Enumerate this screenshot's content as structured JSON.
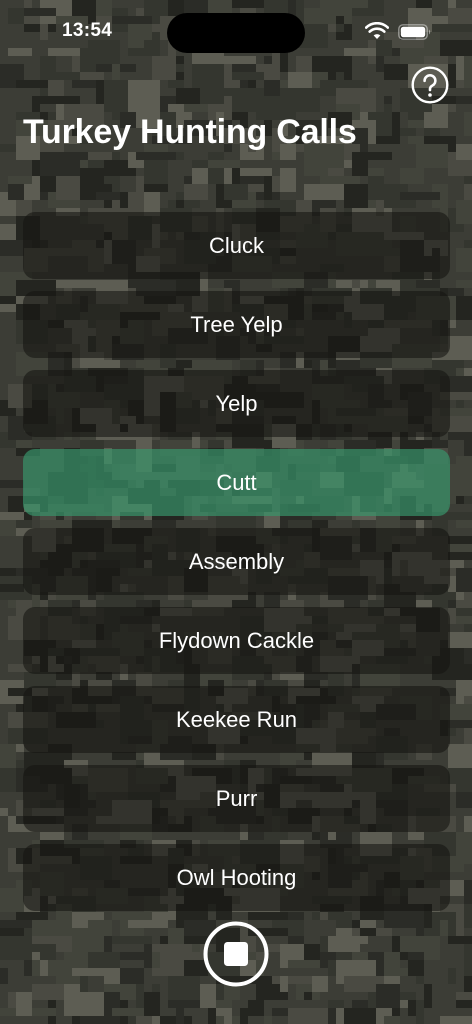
{
  "status_bar": {
    "time": "13:54",
    "wifi_icon": "wifi-icon",
    "battery_icon": "battery-icon"
  },
  "header": {
    "title": "Turkey Hunting Calls",
    "help_icon": "question-mark-circle-icon"
  },
  "calls": [
    {
      "label": "Cluck",
      "active": false
    },
    {
      "label": "Tree Yelp",
      "active": false
    },
    {
      "label": "Yelp",
      "active": false
    },
    {
      "label": "Cutt",
      "active": true
    },
    {
      "label": "Assembly",
      "active": false
    },
    {
      "label": "Flydown Cackle",
      "active": false
    },
    {
      "label": "Keekee Run",
      "active": false
    },
    {
      "label": "Purr",
      "active": false
    },
    {
      "label": "Owl Hooting",
      "active": false
    }
  ],
  "footer": {
    "stop_icon": "stop-circle-icon"
  },
  "colors": {
    "active_call": "#3a8c66",
    "call_button": "#1e1e1a",
    "camo_base": "#3c3d36"
  }
}
